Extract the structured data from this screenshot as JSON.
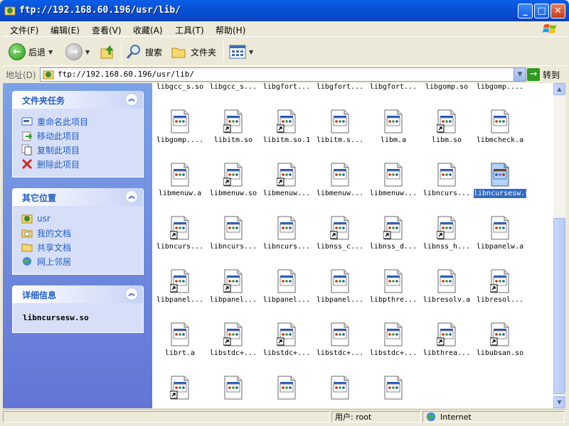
{
  "window": {
    "title": "ftp://192.168.60.196/usr/lib/",
    "min_label": "_",
    "max_label": "□",
    "close_label": "✕"
  },
  "menu": [
    "文件(F)",
    "编辑(E)",
    "查看(V)",
    "收藏(A)",
    "工具(T)",
    "帮助(H)"
  ],
  "toolbar": {
    "back_label": "后退",
    "search_label": "搜索",
    "folders_label": "文件夹"
  },
  "address": {
    "label": "地址(D)",
    "value": "ftp://192.168.60.196/usr/lib/",
    "go_label": "转到"
  },
  "tasks_panel": {
    "title": "文件夹任务",
    "items": [
      {
        "label": "重命名此项目",
        "icon": "rename-icon"
      },
      {
        "label": "移动此项目",
        "icon": "move-icon"
      },
      {
        "label": "复制此项目",
        "icon": "copy-icon"
      },
      {
        "label": "删除此项目",
        "icon": "delete-icon"
      }
    ]
  },
  "places_panel": {
    "title": "其它位置",
    "items": [
      {
        "label": "usr",
        "icon": "ftp-folder-icon"
      },
      {
        "label": "我的文档",
        "icon": "my-documents-icon"
      },
      {
        "label": "共享文档",
        "icon": "shared-documents-icon"
      },
      {
        "label": "网上邻居",
        "icon": "network-places-icon"
      }
    ]
  },
  "details_panel": {
    "title": "详细信息",
    "name": "libncursesw.so"
  },
  "files": [
    {
      "label": "libgcc_s.so",
      "shortcut": false
    },
    {
      "label": "libgcc_s...",
      "shortcut": false
    },
    {
      "label": "libgfort...",
      "shortcut": false
    },
    {
      "label": "libgfort...",
      "shortcut": false
    },
    {
      "label": "libgfort...",
      "shortcut": false
    },
    {
      "label": "libgomp.so",
      "shortcut": false
    },
    {
      "label": "libgomp....",
      "shortcut": false
    },
    {
      "label": "libgomp....",
      "shortcut": false
    },
    {
      "label": "libitm.so",
      "shortcut": true
    },
    {
      "label": "libitm.so.1",
      "shortcut": true
    },
    {
      "label": "libitm.s...",
      "shortcut": false
    },
    {
      "label": "libm.a",
      "shortcut": false
    },
    {
      "label": "libm.so",
      "shortcut": true
    },
    {
      "label": "libmcheck.a",
      "shortcut": false
    },
    {
      "label": "libmenuw.a",
      "shortcut": false
    },
    {
      "label": "libmenuw.so",
      "shortcut": true
    },
    {
      "label": "libmenuw...",
      "shortcut": true
    },
    {
      "label": "libmenuw...",
      "shortcut": false
    },
    {
      "label": "libmenuw...",
      "shortcut": false
    },
    {
      "label": "libncurs...",
      "shortcut": false
    },
    {
      "label": "libncursesw.so",
      "shortcut": false,
      "selected": true
    },
    {
      "label": "libncurs...",
      "shortcut": true
    },
    {
      "label": "libncurs...",
      "shortcut": false
    },
    {
      "label": "libncurs...",
      "shortcut": false
    },
    {
      "label": "libnss_c...",
      "shortcut": true
    },
    {
      "label": "libnss_d...",
      "shortcut": true
    },
    {
      "label": "libnss_h...",
      "shortcut": true
    },
    {
      "label": "libpanelw.a",
      "shortcut": false
    },
    {
      "label": "libpanel...",
      "shortcut": true
    },
    {
      "label": "libpanel...",
      "shortcut": true
    },
    {
      "label": "libpanel...",
      "shortcut": false
    },
    {
      "label": "libpanel...",
      "shortcut": false
    },
    {
      "label": "libpthre...",
      "shortcut": false
    },
    {
      "label": "libresolv.a",
      "shortcut": false
    },
    {
      "label": "libresol...",
      "shortcut": true
    },
    {
      "label": "librt.a",
      "shortcut": false
    },
    {
      "label": "libstdc+...",
      "shortcut": true
    },
    {
      "label": "libstdc+...",
      "shortcut": true
    },
    {
      "label": "libstdc+...",
      "shortcut": false
    },
    {
      "label": "libstdc+...",
      "shortcut": false
    },
    {
      "label": "libthrea...",
      "shortcut": true
    },
    {
      "label": "libubsan.so",
      "shortcut": true
    },
    {
      "label": "",
      "shortcut": true
    },
    {
      "label": "",
      "shortcut": false
    },
    {
      "label": "",
      "shortcut": false
    },
    {
      "label": "",
      "shortcut": false
    },
    {
      "label": "",
      "shortcut": false
    }
  ],
  "status": {
    "user": "用户: root",
    "zone": "Internet"
  },
  "colors": {
    "titlebar": "#0A5FE8",
    "pane_link": "#215DC6",
    "selection": "#316AC5"
  }
}
